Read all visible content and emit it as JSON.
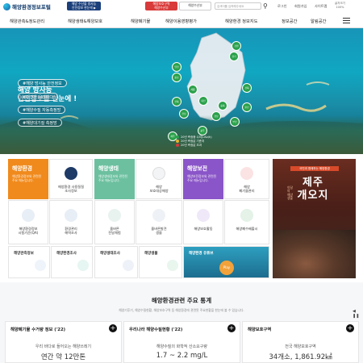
{
  "header": {
    "logo_text": "해양환경정보포털",
    "badge_left": "해양 수산물 방사능\n안전정보 한눈에 ▶",
    "badge_mid": "해양보호구역\n해양수산부",
    "badge_right": "해양수산부",
    "search_placeholder": "검색어를 입력해주세요",
    "utility": [
      "로그인",
      "회원가입",
      "사이트맵"
    ],
    "lang_label": "글자크기",
    "lang_value": "100%"
  },
  "nav": {
    "items": [
      "해양관측&정도관리",
      "해양생태&해양보호",
      "해양폐기물",
      "해양이용영향평가",
      "해양환경 정보지도",
      "정보공간",
      "알림공간"
    ]
  },
  "hero": {
    "title_line1": "해양 방사능",
    "title_line2": "안전정보를 한눈에 !",
    "pills": [
      "#해양 방사능 안전정보",
      "#안전한 우리바다",
      "#해양수질 자동측정망",
      "#해양대기질 측정망"
    ],
    "regions": [
      "인천",
      "경기",
      "강원",
      "충남",
      "세종",
      "대전",
      "충북",
      "전북",
      "경북",
      "대구",
      "전남",
      "광주",
      "경남",
      "울산",
      "부산",
      "제주"
    ],
    "legend": [
      "20년 측정중 수치(uSv/h)",
      "20년 측정값 기준치",
      "20년 측정값 초과"
    ]
  },
  "tiles": {
    "cat1_title": "해양환경",
    "cat1_sub": "해양환경정보와 관련된\n주요 메뉴입니다.",
    "cat2_title": "해양생태",
    "cat2_sub": "해양생태정보와 관련된\n주요 메뉴입니다.",
    "cat3_title": "해양보전",
    "cat3_sub": "해양보전정보와 관련된\n주요 메뉴입니다.",
    "r1": [
      "해양환경 사용질질\n조사정보",
      "해양\n보호대상해양",
      "해양\n폐기물관리",
      "해양보호구역"
    ],
    "r2": [
      "해양환경정보\n시험기준(QA)",
      "환경관리\n해역조사",
      "올바른\n전달체험",
      "올바른발견\n생물",
      "해양보호활동",
      "해양폐수배출시"
    ],
    "r3_titles": [
      "해양관측정보",
      "해양환경조사",
      "해양생태조사",
      "해양생물"
    ],
    "r3_desc": [
      "해양관측정보 자료 해양관측을 실시하고 있습니다.",
      "연안 및 근해에서 해양환경을 실시하여 자료를 제공합니다.",
      "해양생태계 보전과 관리를 위한 생태조사 결과를 제공합니다.",
      "연안을 포함한 해역 해양생물 분포 현황을 제공합니다."
    ],
    "video_label": "해양환경 유튜브",
    "play": "Play"
  },
  "poster": {
    "tag": "국민과 함께하는 해양환경",
    "title": "제주\n개오지",
    "side": "이달의 해양생물"
  },
  "stats": {
    "title": "해양환경관련 주요 통계",
    "subtitle": "해양기후기, 해양수질현황, 해양보호구역 등 해양환경에 관련된 주요현황을 한눈에 볼 수 있습니다.",
    "cards": [
      {
        "head": "해양폐기물 수거량 정보 ('22)",
        "label": "우리 바다로 들어오는 해양쓰레기",
        "value": "연간 약 12만톤"
      },
      {
        "head": "우리나라 해양수질현황 ('22)",
        "label": "해양수질의 화학적 산소요구량",
        "value": "1.7 ~ 2.2 mg/L"
      },
      {
        "head": "해양보호구역",
        "label": "전국 해양보호구역",
        "value": "34개소, 1,861.92㎢"
      }
    ]
  }
}
